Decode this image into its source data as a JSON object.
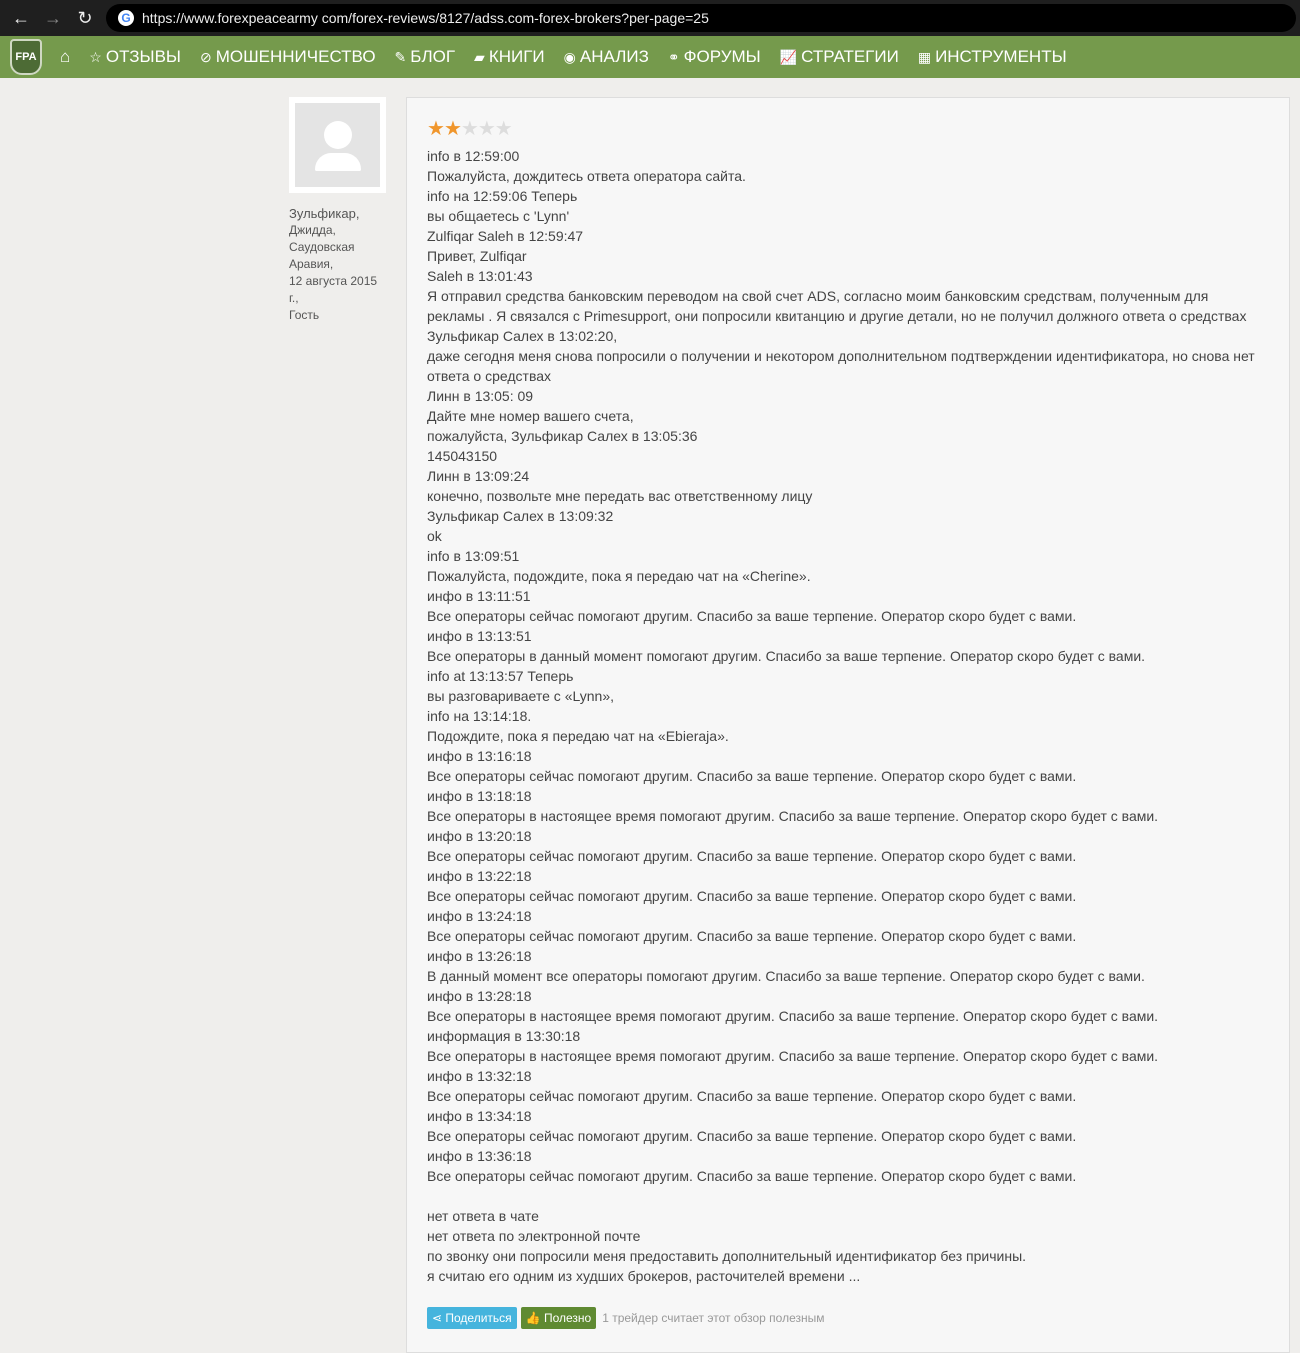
{
  "browser": {
    "url": "https://www.forexpeacearmy com/forex-reviews/8127/adss.com-forex-brokers?per-page=25"
  },
  "nav": {
    "logo": "FPA",
    "items": [
      {
        "icon": "star-icon",
        "glyph": "☆",
        "label": "ОТЗЫВЫ"
      },
      {
        "icon": "ban-icon",
        "glyph": "⊘",
        "label": "МОШЕННИЧЕСТВО"
      },
      {
        "icon": "pencil-icon",
        "glyph": "✎",
        "label": "БЛОГ"
      },
      {
        "icon": "book-icon",
        "glyph": "▰",
        "label": "КНИГИ"
      },
      {
        "icon": "podcast-icon",
        "glyph": "◉",
        "label": "АНАЛИЗ"
      },
      {
        "icon": "handshake-icon",
        "glyph": "⚭",
        "label": "ФОРУМЫ"
      },
      {
        "icon": "line-chart-icon",
        "glyph": "📈",
        "label": "СТРАТЕГИИ"
      },
      {
        "icon": "calculator-icon",
        "glyph": "▦",
        "label": "ИНСТРУМЕНТЫ"
      }
    ]
  },
  "author": {
    "name": "Зульфикар,",
    "meta": [
      "Джидда,",
      "Саудовская",
      "Аравия,",
      "12 августа 2015",
      "г.,",
      "Гость"
    ]
  },
  "review": {
    "rating": 2,
    "max_rating": 5,
    "lines": [
      "info в 12:59:00",
      "Пожалуйста, дождитесь ответа оператора сайта.",
      "info на 12:59:06 Теперь",
      "вы общаетесь с 'Lynn'",
      "Zulfiqar Saleh в 12:59:47",
      "Привет, Zulfiqar",
      "Saleh в 13:01:43",
      "Я отправил средства банковским переводом на свой счет ADS, согласно моим банковским средствам, полученным для",
      "рекламы . Я связался с Primesupport, они попросили квитанцию и другие детали, но не получил должного ответа о средствах",
      "Зульфикар Салех в 13:02:20,",
      "даже сегодня меня снова попросили о получении и некотором дополнительном подтверждении идентификатора, но снова нет",
      "ответа о средствах",
      "Линн в 13:05: 09",
      "Дайте мне номер вашего счета,",
      "пожалуйста, Зульфикар Салех в 13:05:36",
      "145043150",
      "Линн в 13:09:24",
      "конечно, позвольте мне передать вас ответственному лицу",
      "Зульфикар Салех в 13:09:32",
      "ok",
      "info в 13:09:51",
      "Пожалуйста, подождите, пока я передаю чат на «Cherine».",
      "инфо в 13:11:51",
      "Все операторы сейчас помогают другим. Спасибо за ваше терпение. Оператор скоро будет с вами.",
      "инфо в 13:13:51",
      "Все операторы в данный момент помогают другим. Спасибо за ваше терпение. Оператор скоро будет с вами.",
      "info at 13:13:57 Теперь",
      "вы разговариваете с «Lynn»,",
      "info на 13:14:18.",
      "Подождите, пока я передаю чат на «Ebieraja».",
      "инфо в 13:16:18",
      "Все операторы сейчас помогают другим. Спасибо за ваше терпение. Оператор скоро будет с вами.",
      "инфо в 13:18:18",
      "Все операторы в настоящее время помогают другим. Спасибо за ваше терпение. Оператор скоро будет с вами.",
      "инфо в 13:20:18",
      "Все операторы сейчас помогают другим. Спасибо за ваше терпение. Оператор скоро будет с вами.",
      "инфо в 13:22:18",
      "Все операторы сейчас помогают другим. Спасибо за ваше терпение. Оператор скоро будет с вами.",
      "инфо в 13:24:18",
      "Все операторы сейчас помогают другим. Спасибо за ваше терпение. Оператор скоро будет с вами.",
      "инфо в 13:26:18",
      "В данный момент все операторы помогают другим. Спасибо за ваше терпение. Оператор скоро будет с вами.",
      "инфо в 13:28:18",
      "Все операторы в настоящее время помогают другим. Спасибо за ваше терпение. Оператор скоро будет с вами.",
      "информация в 13:30:18",
      "Все операторы в настоящее время помогают другим. Спасибо за ваше терпение. Оператор скоро будет с вами.",
      "инфо в 13:32:18",
      "Все операторы сейчас помогают другим. Спасибо за ваше терпение. Оператор скоро будет с вами.",
      "инфо в 13:34:18",
      "Все операторы сейчас помогают другим. Спасибо за ваше терпение. Оператор скоро будет с вами.",
      "инфо в 13:36:18",
      "Все операторы сейчас помогают другим. Спасибо за ваше терпение. Оператор скоро будет с вами.",
      "",
      "нет ответа в чате",
      "нет ответа по электронной почте",
      "по звонку они попросили меня предоставить дополнительный идентификатор без причины.",
      "я считаю его одним из худших брокеров, расточителей времени ..."
    ],
    "share_label": "Поделиться",
    "useful_label": "Полезно",
    "useful_note": "1 трейдер считает этот обзор полезным"
  },
  "colors": {
    "nav": "#759a4c",
    "star": "#f0962c",
    "share": "#45b4dd",
    "useful": "#5f8a32"
  }
}
